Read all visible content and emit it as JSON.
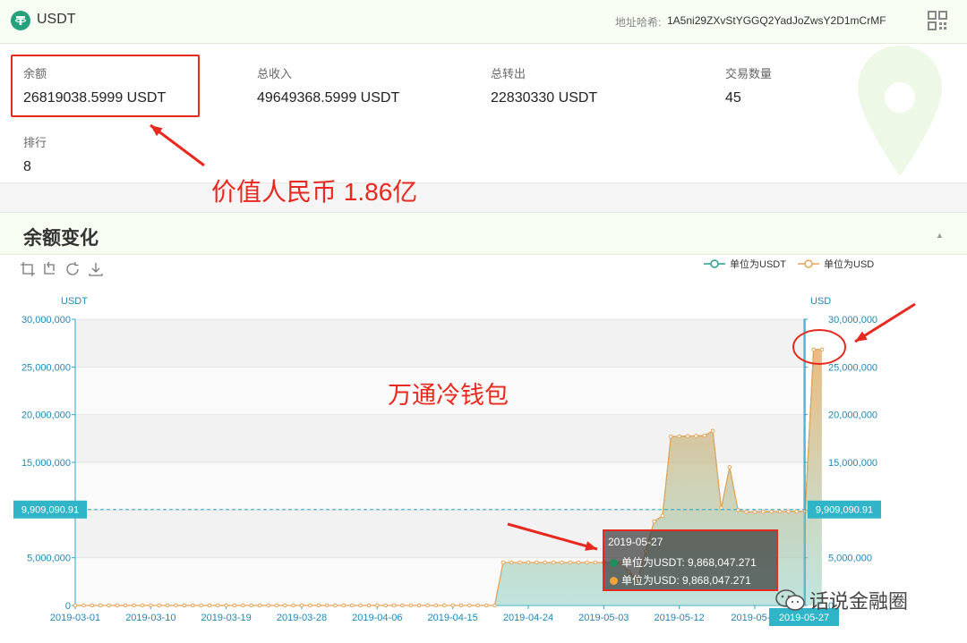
{
  "header": {
    "app_title": "USDT",
    "address_label": "地址哈希:",
    "address_value": "1A5ni29ZXvStYGGQ2YadJoZwsY2D1mCrMF"
  },
  "stats": {
    "balance": {
      "label": "余额",
      "value": "26819038.5999 USDT"
    },
    "total_in": {
      "label": "总收入",
      "value": "49649368.5999 USDT"
    },
    "total_out": {
      "label": "总转出",
      "value": "22830330 USDT"
    },
    "tx_count": {
      "label": "交易数量",
      "value": "45"
    },
    "rank": {
      "label": "排行",
      "value": "8"
    }
  },
  "annotations": {
    "value_cny": "价值人民币 1.86亿",
    "wallet_name": "万通冷钱包"
  },
  "section": {
    "title": "余额变化"
  },
  "colors": {
    "accent_green": "#26a17b",
    "usdt_series": "#2a9d8f",
    "usd_series": "#e6a456",
    "axis_label": "#1e88b8",
    "annotation_red": "#e8291f"
  },
  "chart_data": {
    "type": "area",
    "legend": [
      "单位为USDT",
      "单位为USD"
    ],
    "legend_position": "top-right",
    "y_left_label": "USDT",
    "y_right_label": "USD",
    "ylim": [
      0,
      30000000
    ],
    "y_ticks": [
      "0",
      "5,000,000",
      "10,000,000",
      "15,000,000",
      "20,000,000",
      "25,000,000",
      "30,000,000"
    ],
    "x_ticks": [
      "2019-03-01",
      "2019-03-10",
      "2019-03-19",
      "2019-03-28",
      "2019-04-06",
      "2019-04-15",
      "2019-04-24",
      "2019-05-03",
      "2019-05-12",
      "2019-05-..."
    ],
    "grid": true,
    "crosshair_value": "9,909,090.91",
    "crosshair_date": "2019-05-27",
    "x_start": "2019-03-01",
    "points": [
      [
        "2019-03-01",
        0
      ],
      [
        "2019-04-20",
        0
      ],
      [
        "2019-04-21",
        4500000
      ],
      [
        "2019-05-05",
        4500000
      ],
      [
        "2019-05-07",
        2600000
      ],
      [
        "2019-05-09",
        8800000
      ],
      [
        "2019-05-10",
        9400000
      ],
      [
        "2019-05-11",
        17700000
      ],
      [
        "2019-05-15",
        17800000
      ],
      [
        "2019-05-16",
        18300000
      ],
      [
        "2019-05-17",
        10200000
      ],
      [
        "2019-05-18",
        14500000
      ],
      [
        "2019-05-19",
        10000000
      ],
      [
        "2019-05-20",
        9800000
      ],
      [
        "2019-05-27",
        9868047.271
      ],
      [
        "2019-05-28",
        26819038.5999
      ],
      [
        "2019-05-29",
        26819038.5999
      ]
    ],
    "series": [
      {
        "name": "单位为USDT",
        "color": "#2a9d8f"
      },
      {
        "name": "单位为USD",
        "color": "#e6a456"
      }
    ],
    "tooltip": {
      "date": "2019-05-27",
      "rows": [
        {
          "label": "单位为USDT: 9,868,047.271"
        },
        {
          "label": "单位为USD: 9,868,047.271"
        }
      ]
    }
  },
  "watermark": "话说金融圈"
}
